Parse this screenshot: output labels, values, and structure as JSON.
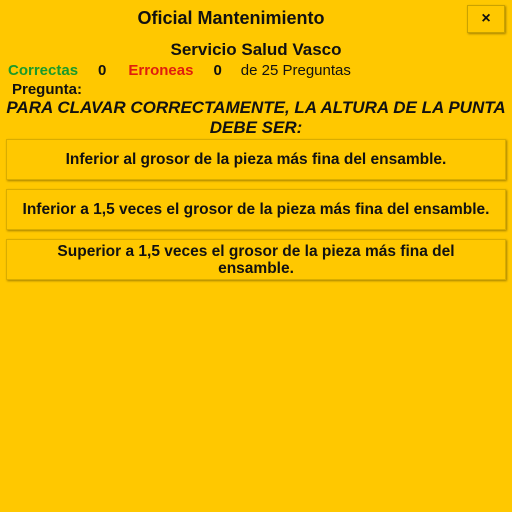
{
  "header": {
    "title": "Oficial Mantenimiento",
    "close_label": "×",
    "subtitle": "Servicio Salud Vasco"
  },
  "score": {
    "correct_label": "Correctas",
    "correct_count": "0",
    "wrong_label": "Erroneas",
    "wrong_count": "0",
    "total_text": "de 25 Preguntas",
    "correct_color": "#1a9a2a",
    "wrong_color": "#e01d0d"
  },
  "question": {
    "label": "Pregunta:",
    "text": "PARA CLAVAR CORRECTAMENTE, LA ALTURA DE LA PUNTA DEBE SER:"
  },
  "answers": [
    {
      "text": "Inferior al grosor de la pieza más fina del ensamble."
    },
    {
      "text": "Inferior a 1,5 veces el grosor de la pieza más fina del ensamble."
    },
    {
      "text": "Superior a 1,5 veces el grosor de la pieza más fina del ensamble."
    }
  ],
  "colors": {
    "background": "#FFC800"
  }
}
